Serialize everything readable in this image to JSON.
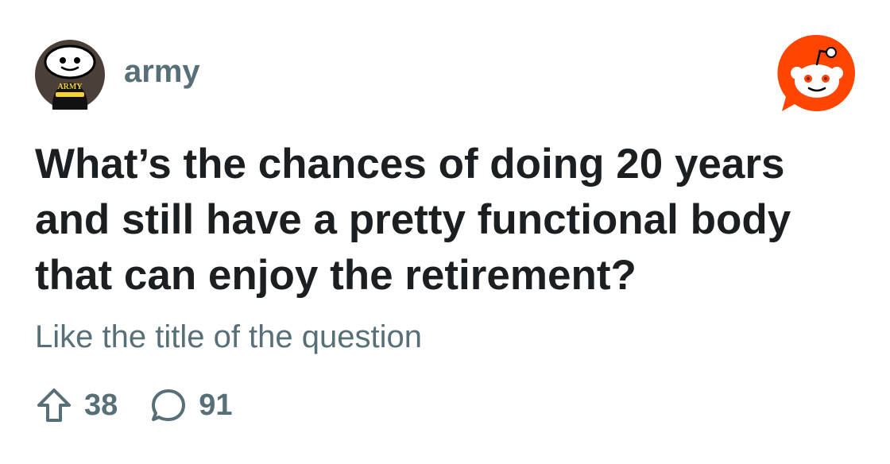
{
  "community": {
    "name": "army",
    "avatar_badge_text": "ARMY",
    "avatar_icon": "snoo-army-avatar-icon"
  },
  "brand": {
    "logo_icon": "reddit-logo-icon",
    "accent_color": "#ff4500"
  },
  "post": {
    "title": "What’s the chances of doing 20 years and still have a pretty functional body that can enjoy the retirement?",
    "body": "Like the title of the question"
  },
  "stats": {
    "upvotes": "38",
    "upvote_icon": "upvote-arrow-icon",
    "comments": "91",
    "comment_icon": "comment-bubble-icon"
  },
  "colors": {
    "title": "#1c1f21",
    "meta": "#576f76",
    "background": "#ffffff"
  }
}
